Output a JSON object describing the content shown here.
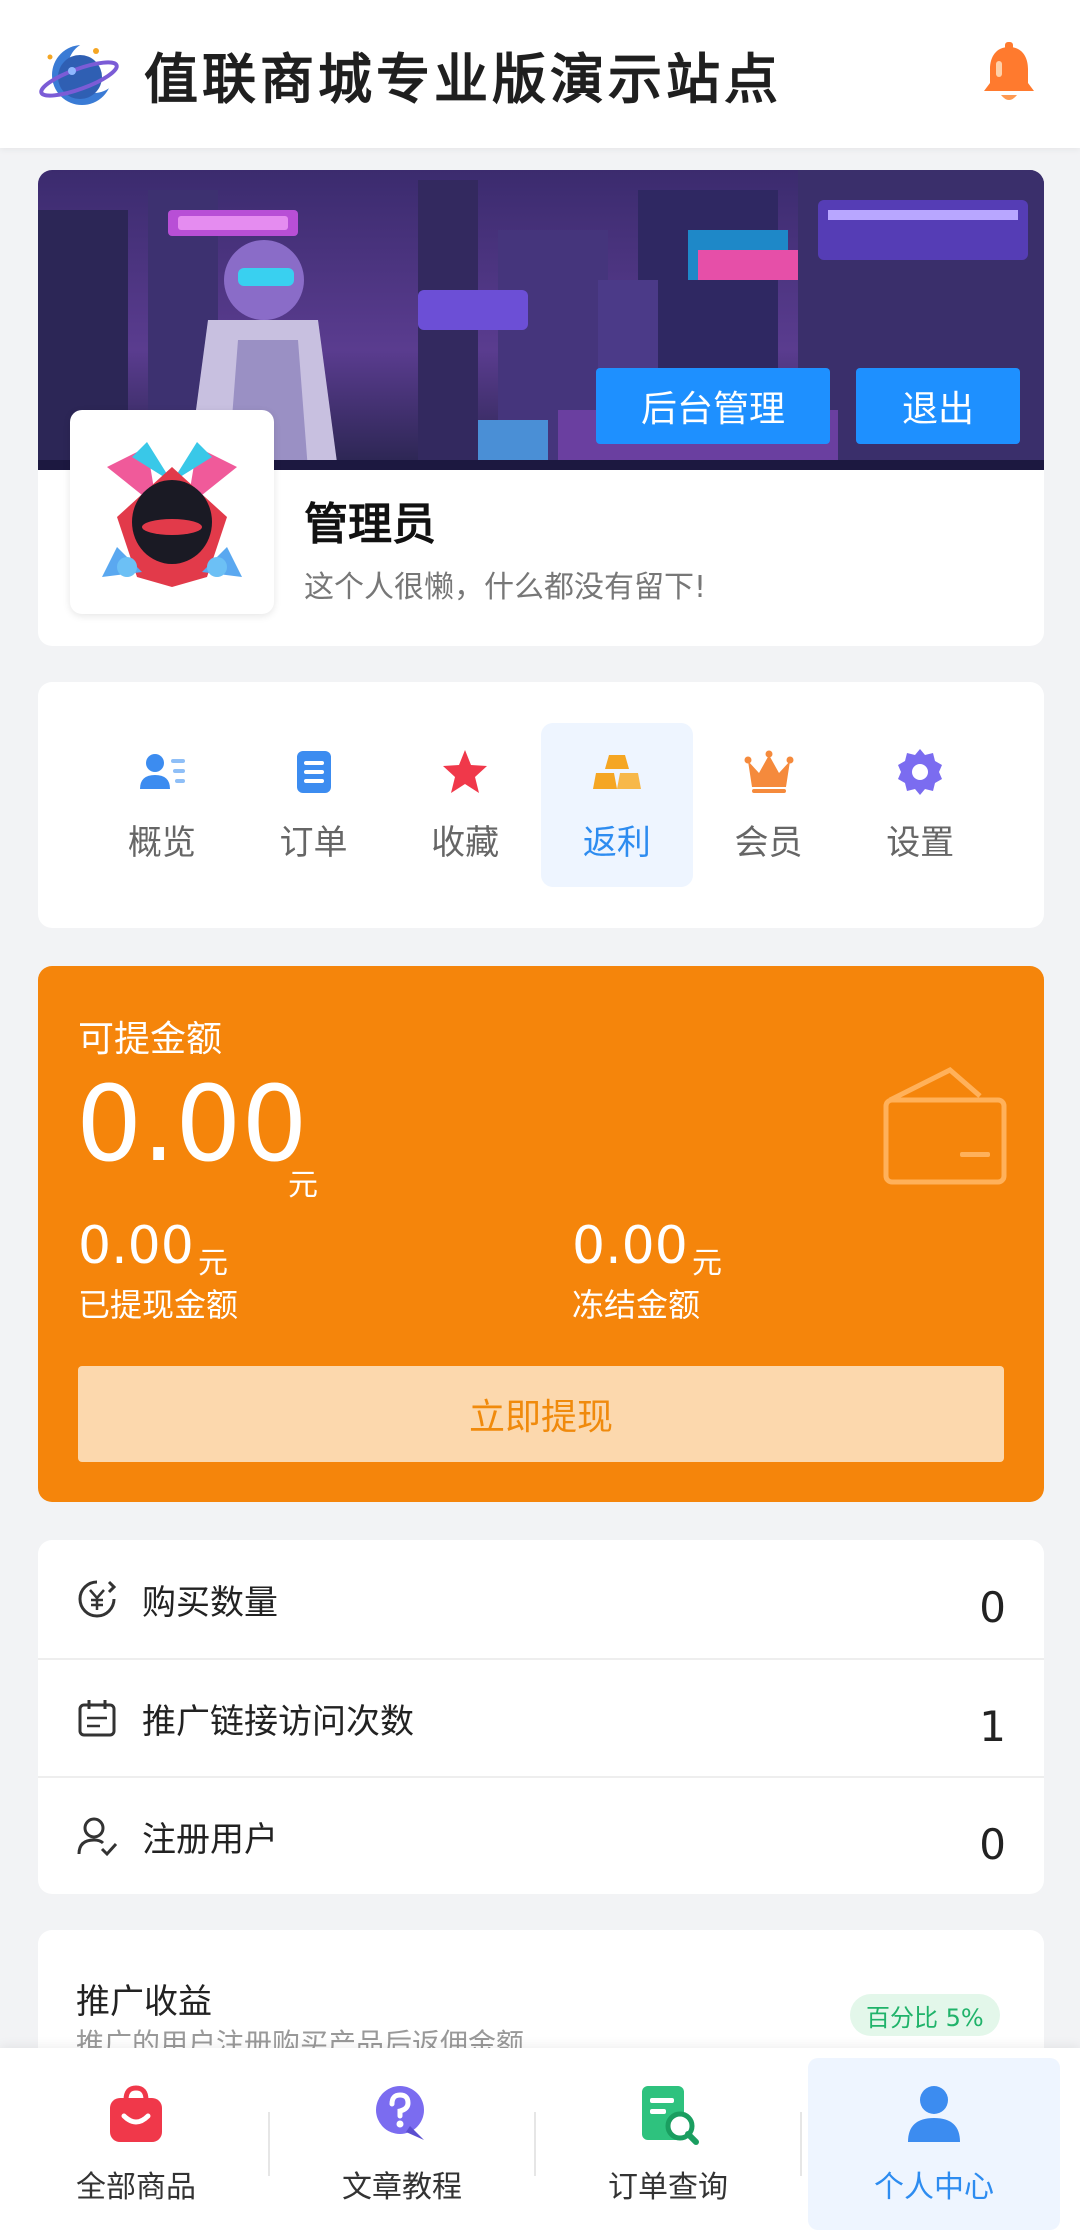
{
  "header": {
    "title": "值联商城专业版演示站点",
    "logo_icon": "moon-planet-logo",
    "bell_icon": "bell-icon"
  },
  "profile": {
    "admin_button": "后台管理",
    "logout_button": "退出",
    "name": "管理员",
    "bio": "这个人很懒，什么都没有留下!"
  },
  "tabs": [
    {
      "label": "概览",
      "icon": "user-list-icon",
      "color": "#3c8cf0"
    },
    {
      "label": "订单",
      "icon": "document-icon",
      "color": "#3c8cf0"
    },
    {
      "label": "收藏",
      "icon": "star-icon",
      "color": "#f0384a"
    },
    {
      "label": "返利",
      "icon": "gold-bars-icon",
      "color": "#f5a623",
      "active": true
    },
    {
      "label": "会员",
      "icon": "crown-icon",
      "color": "#f58a3c"
    },
    {
      "label": "设置",
      "icon": "gear-icon",
      "color": "#7b6cf0"
    }
  ],
  "balance": {
    "title": "可提金额",
    "amount": "0.00",
    "unit": "元",
    "withdrawn_amount": "0.00",
    "withdrawn_unit": "元",
    "withdrawn_label": "已提现金额",
    "frozen_amount": "0.00",
    "frozen_unit": "元",
    "frozen_label": "冻结金额",
    "withdraw_button": "立即提现",
    "color": "#f5850b"
  },
  "stats": [
    {
      "label": "购买数量",
      "value": "0",
      "icon": "yen-circle-icon"
    },
    {
      "label": "推广链接访问次数",
      "value": "1",
      "icon": "calendar-icon"
    },
    {
      "label": "注册用户",
      "value": "0",
      "icon": "user-check-icon"
    }
  ],
  "earnings": {
    "title": "推广收益",
    "desc": "推广的用户注册购买产品后返佣金额",
    "badge": "百分比 5%"
  },
  "bottom_nav": [
    {
      "label": "全部商品",
      "icon": "shopping-bag-icon"
    },
    {
      "label": "文章教程",
      "icon": "question-chat-icon"
    },
    {
      "label": "订单查询",
      "icon": "order-search-icon"
    },
    {
      "label": "个人中心",
      "icon": "person-icon",
      "active": true
    }
  ]
}
